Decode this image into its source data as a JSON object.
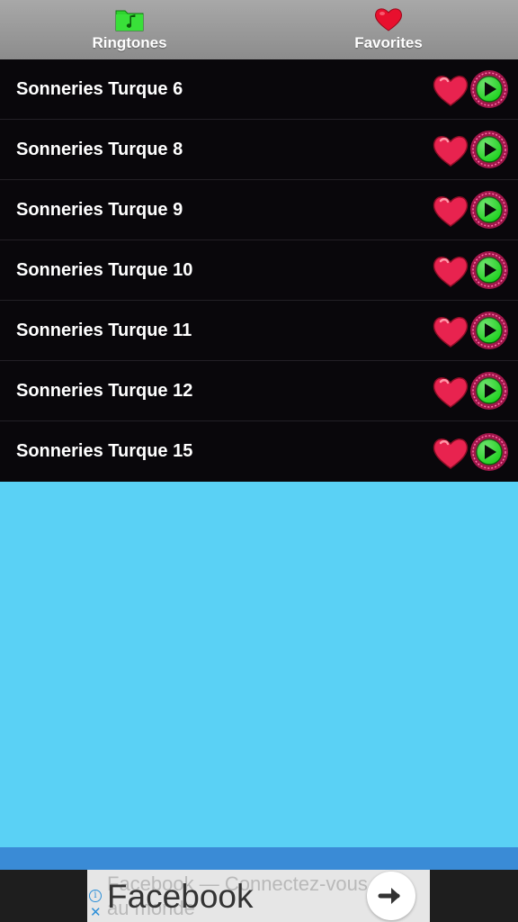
{
  "tabs": [
    {
      "label": "Ringtones",
      "icon": "folder-music-icon"
    },
    {
      "label": "Favorites",
      "icon": "heart-icon"
    }
  ],
  "ringtones": [
    {
      "title": "Sonneries Turque 6"
    },
    {
      "title": "Sonneries Turque 8"
    },
    {
      "title": "Sonneries Turque 9"
    },
    {
      "title": "Sonneries Turque 10"
    },
    {
      "title": "Sonneries Turque 11"
    },
    {
      "title": "Sonneries Turque 12"
    },
    {
      "title": "Sonneries Turque 15"
    }
  ],
  "ad": {
    "title": "Facebook",
    "subtitle": "Facebook — Connectez-vous au monde"
  },
  "colors": {
    "list_background": "#09070b",
    "content_background": "#5ad1f5",
    "heart": "#e8234f",
    "play_green": "#22d322"
  }
}
